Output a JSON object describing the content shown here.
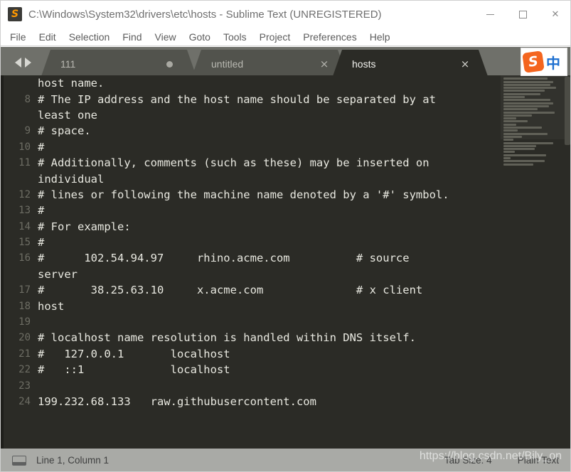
{
  "window": {
    "title": "C:\\Windows\\System32\\drivers\\etc\\hosts - Sublime Text (UNREGISTERED)",
    "logo_icon": "sublime-text-logo",
    "controls": {
      "minimize": "minimize-icon",
      "maximize": "maximize-icon",
      "close": "close-icon"
    }
  },
  "menubar": {
    "items": [
      {
        "label": "File"
      },
      {
        "label": "Edit"
      },
      {
        "label": "Selection"
      },
      {
        "label": "Find"
      },
      {
        "label": "View"
      },
      {
        "label": "Goto"
      },
      {
        "label": "Tools"
      },
      {
        "label": "Project"
      },
      {
        "label": "Preferences"
      },
      {
        "label": "Help"
      }
    ]
  },
  "tabbar": {
    "nav_prev_icon": "chevron-left-icon",
    "nav_next_icon": "chevron-right-icon",
    "tabs": [
      {
        "label": "111",
        "active": false,
        "dirty": true,
        "close_glyph": ""
      },
      {
        "label": "untitled",
        "active": false,
        "dirty": false,
        "close_glyph": "×"
      },
      {
        "label": "hosts",
        "active": true,
        "dirty": false,
        "close_glyph": "×"
      }
    ]
  },
  "ime": {
    "logo_label": "S",
    "mode_label": "中"
  },
  "editor": {
    "colors": {
      "background": "#2b2b26",
      "foreground": "#e8e8e0",
      "line_number": "#6d6d64",
      "tab_active": "#2b2b26",
      "tab_inactive": "#52534d",
      "tabbar_background": "#6f706a",
      "statusbar_background": "#a9aaa6",
      "accent_orange": "#ff9800"
    },
    "lines": [
      {
        "number": "",
        "text": "host name."
      },
      {
        "number": "8",
        "text": "# The IP address and the host name should be separated by at"
      },
      {
        "number": "",
        "text": "least one"
      },
      {
        "number": "9",
        "text": "# space."
      },
      {
        "number": "10",
        "text": "#"
      },
      {
        "number": "11",
        "text": "# Additionally, comments (such as these) may be inserted on"
      },
      {
        "number": "",
        "text": "individual"
      },
      {
        "number": "12",
        "text": "# lines or following the machine name denoted by a '#' symbol."
      },
      {
        "number": "13",
        "text": "#"
      },
      {
        "number": "14",
        "text": "# For example:"
      },
      {
        "number": "15",
        "text": "#"
      },
      {
        "number": "16",
        "text": "#      102.54.94.97     rhino.acme.com          # source"
      },
      {
        "number": "",
        "text": "server"
      },
      {
        "number": "17",
        "text": "#       38.25.63.10     x.acme.com              # x client"
      },
      {
        "number": "18",
        "text": "host"
      },
      {
        "number": "19",
        "text": ""
      },
      {
        "number": "20",
        "text": "# localhost name resolution is handled within DNS itself."
      },
      {
        "number": "21",
        "text": "#   127.0.0.1       localhost"
      },
      {
        "number": "22",
        "text": "#   ::1             localhost"
      },
      {
        "number": "23",
        "text": ""
      },
      {
        "number": "24",
        "text": "199.232.68.133   raw.githubusercontent.com"
      }
    ],
    "minimap_rows": [
      62,
      70,
      66,
      74,
      58,
      52,
      30,
      66,
      70,
      64,
      48,
      72,
      40,
      18,
      34,
      18,
      54,
      20,
      62,
      26,
      14,
      70,
      46,
      44,
      16,
      60,
      10,
      58,
      42
    ]
  },
  "statusbar": {
    "icon": "layout-icon",
    "cursor_position": "Line 1, Column 1",
    "tab_size": "Tab Size: 4",
    "syntax": "Plain Text"
  },
  "watermark": {
    "text": "https://blog.csdn.net/Bily_on"
  }
}
